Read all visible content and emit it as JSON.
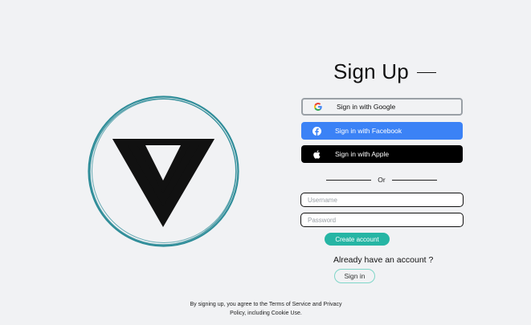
{
  "signup": {
    "title": "Sign Up",
    "google_label": "Sign in with Google",
    "facebook_label": "Sign in with Facebook",
    "apple_label": "Sign in with Apple",
    "or_label": "Or",
    "username_placeholder": "Username",
    "password_placeholder": "Password",
    "create_label": "Create account",
    "already_label": "Already have an account ?",
    "signin_label": "Sign in",
    "terms_line1": "By signing up, you agree to the Terms of Service and Privacy",
    "terms_line2": "Policy, including Cookie Use."
  },
  "icons": {
    "logo": "v-logo-in-circle",
    "google": "google-icon",
    "facebook": "facebook-icon",
    "apple": "apple-icon"
  },
  "colors": {
    "background": "#f1f2f4",
    "logo_ring": "#2f8d99",
    "facebook": "#3b82f6",
    "apple": "#000000",
    "create_account": "#26b5a4",
    "signin_border": "#7fd6c8"
  }
}
